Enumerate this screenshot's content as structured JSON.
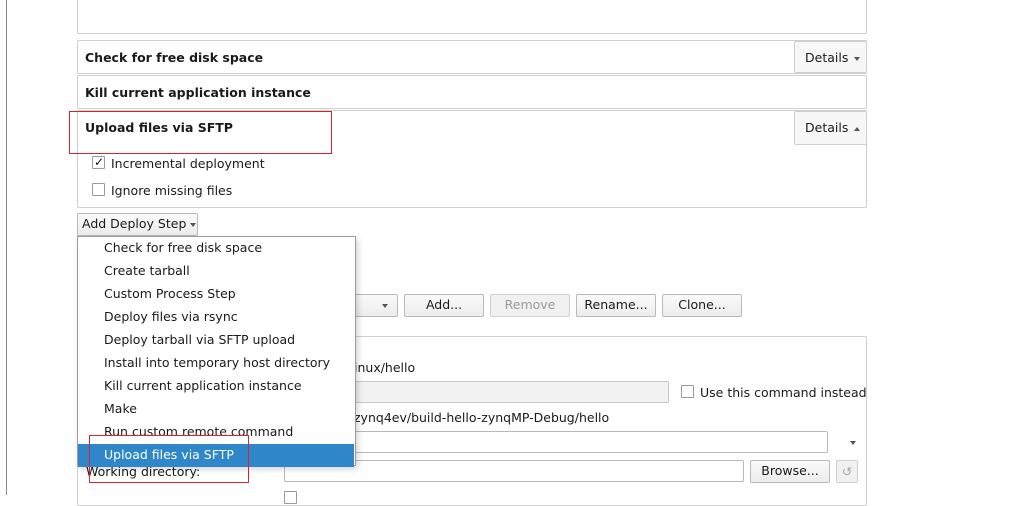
{
  "deploy_steps": [
    {
      "title": "Check for free disk space",
      "details_label": "Details"
    },
    {
      "title": "Kill current application instance"
    },
    {
      "title": "Upload files via SFTP",
      "details_label": "Details",
      "options": [
        {
          "label": "Incremental deployment",
          "checked": true
        },
        {
          "label": "Ignore missing files",
          "checked": false
        }
      ]
    }
  ],
  "add_deploy_step_label": "Add Deploy Step",
  "menu_items": [
    "Check for free disk space",
    "Create tarball",
    "Custom Process Step",
    "Deploy files via rsync",
    "Deploy tarball via SFTP upload",
    "Install into temporary host directory",
    "Kill current application instance",
    "Make",
    "Run custom remote command",
    "Upload files via SFTP"
  ],
  "selected_menu_item": "Upload files via SFTP",
  "run_config_buttons": {
    "add": "Add...",
    "remove": "Remove",
    "rename": "Rename...",
    "clone": "Clone..."
  },
  "run_settings": {
    "executable_partial": "inux/hello",
    "use_command_instead_label": "Use this command instead",
    "path_partial": "zynq4ev/build-hello-zynqMP-Debug/hello",
    "working_directory_label": "Working directory:",
    "browse_label": "Browse..."
  },
  "colors": {
    "highlight_box": "#d9232e",
    "menu_selection": "#2f86c8"
  }
}
